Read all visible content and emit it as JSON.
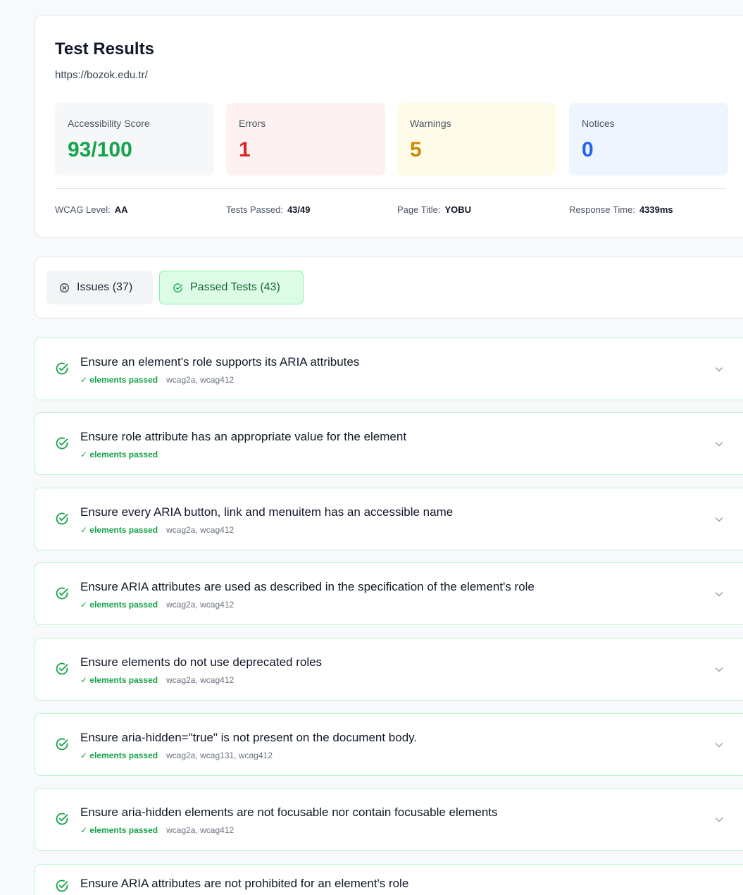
{
  "results": {
    "title": "Test Results",
    "url": "https://bozok.edu.tr/",
    "stats": {
      "score_label": "Accessibility Score",
      "score_value": "93/100",
      "errors_label": "Errors",
      "errors_value": "1",
      "warnings_label": "Warnings",
      "warnings_value": "5",
      "notices_label": "Notices",
      "notices_value": "0"
    },
    "meta": {
      "wcag_label": "WCAG Level:",
      "wcag_value": "AA",
      "tests_label": "Tests Passed:",
      "tests_value": "43/49",
      "title_label": "Page Title:",
      "title_value": "YOBU",
      "time_label": "Response Time:",
      "time_value": "4339ms"
    }
  },
  "tabs": {
    "issues_label": "Issues (37)",
    "passed_label": "Passed Tests (43)",
    "issues_icon": "x-circle-icon",
    "passed_icon": "check-circle-icon"
  },
  "passed_tests": [
    {
      "name": "Ensure an element's role supports its ARIA attributes",
      "status": "✓ elements passed",
      "tags": "wcag2a, wcag412"
    },
    {
      "name": "Ensure role attribute has an appropriate value for the element",
      "status": "✓ elements passed",
      "tags": ""
    },
    {
      "name": "Ensure every ARIA button, link and menuitem has an accessible name",
      "status": "✓ elements passed",
      "tags": "wcag2a, wcag412"
    },
    {
      "name": "Ensure ARIA attributes are used as described in the specification of the element's role",
      "status": "✓ elements passed",
      "tags": "wcag2a, wcag412"
    },
    {
      "name": "Ensure elements do not use deprecated roles",
      "status": "✓ elements passed",
      "tags": "wcag2a, wcag412"
    },
    {
      "name": "Ensure aria-hidden=\"true\" is not present on the document body.",
      "status": "✓ elements passed",
      "tags": "wcag2a, wcag131, wcag412"
    },
    {
      "name": "Ensure aria-hidden elements are not focusable nor contain focusable elements",
      "status": "✓ elements passed",
      "tags": "wcag2a, wcag412"
    },
    {
      "name": "Ensure ARIA attributes are not prohibited for an element's role",
      "status": "",
      "tags": ""
    }
  ],
  "colors": {
    "success": "#16a34a",
    "error": "#dc2626",
    "warning": "#ca8a04",
    "notice": "#2563eb"
  }
}
